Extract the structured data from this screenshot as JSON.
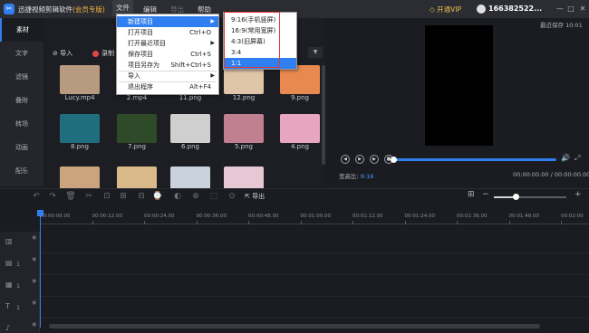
{
  "titlebar": {
    "app_title": "迅捷视频剪辑软件",
    "vip_tag": "(会员专版)",
    "menu": {
      "file": "文件",
      "edit": "编辑",
      "export": "导出",
      "help": "帮助"
    },
    "vip_button": "开通VIP",
    "user": "166382522...",
    "minimize": "—",
    "maximize": "□",
    "close": "✕"
  },
  "leftnav": {
    "items": [
      {
        "label": "素材"
      },
      {
        "label": "文字"
      },
      {
        "label": "滤镜"
      },
      {
        "label": "叠附"
      },
      {
        "label": "转场"
      },
      {
        "label": "动画"
      },
      {
        "label": "配乐"
      }
    ]
  },
  "media": {
    "import_label": "导入",
    "record_label": "录制",
    "sort_arrow": "▼",
    "items": [
      {
        "name": "Lucy.mp4",
        "color": "#b89a80"
      },
      {
        "name": "2.mp4",
        "color": "#d9d2c3"
      },
      {
        "name": "11.png",
        "color": "#2a3a4a"
      },
      {
        "name": "12.png",
        "color": "#e0c6a8"
      },
      {
        "name": "9.png",
        "color": "#e88a50"
      },
      {
        "name": "8.png",
        "color": "#1f6d7d"
      },
      {
        "name": "7.png",
        "color": "#2f4a28"
      },
      {
        "name": "6.png",
        "color": "#cfcfcf"
      },
      {
        "name": "5.png",
        "color": "#c08090"
      },
      {
        "name": "4.png",
        "color": "#e7a5c0"
      },
      {
        "name": "",
        "color": "#caa47c"
      },
      {
        "name": "",
        "color": "#d9b98a"
      },
      {
        "name": "",
        "color": "#cad2de"
      },
      {
        "name": "",
        "color": "#e6c7d4"
      }
    ]
  },
  "preview": {
    "last_save": "最近保存 10:01",
    "ratio_label": "宽高比:",
    "ratio_value": "9:16",
    "time": "00:00:00.00 / 00:00:00.00",
    "btn_prev": "◀",
    "btn_play": "▶",
    "btn_next": "▶",
    "btn_stop": "■",
    "volume_icon": "🔊",
    "fullscreen_icon": "⤢"
  },
  "toolbar": {
    "export_label": "导出",
    "icons": [
      "↶",
      "↷",
      "🗑",
      "✂",
      "⊡",
      "⊞",
      "⊟",
      "⌚",
      "◐",
      "⊕",
      "⬚",
      "⊙",
      "🎤",
      "≡"
    ],
    "zoom_out": "−",
    "zoom_in": "+",
    "zoom_level": 0.3
  },
  "timeline": {
    "ticks": [
      "00:00:00.00",
      "00:00:12.00",
      "00:00:24.00",
      "00:00:36.00",
      "00:00:48.00",
      "00:01:00.00",
      "00:01:12.00",
      "00:01:24.00",
      "00:01:36.00",
      "00:01:48.00",
      "00:02:00"
    ],
    "tracks": [
      {
        "icon": "▥",
        "index": "",
        "eye": "◉"
      },
      {
        "icon": "▤",
        "index": "1",
        "eye": "◉"
      },
      {
        "icon": "▦",
        "index": "1",
        "eye": "◉"
      },
      {
        "icon": "T",
        "index": "1",
        "eye": "◉"
      },
      {
        "icon": "♪",
        "index": "",
        "eye": "◉"
      }
    ]
  },
  "file_menu": {
    "items": [
      {
        "label": "新建项目",
        "shortcut": "",
        "arrow": "▶",
        "highlighted": true
      },
      {
        "label": "打开项目",
        "shortcut": "Ctrl+O",
        "arrow": "",
        "highlighted": false
      },
      {
        "label": "打开最近项目",
        "shortcut": "",
        "arrow": "▶",
        "highlighted": false
      },
      {
        "label": "保存项目",
        "shortcut": "Ctrl+S",
        "arrow": "",
        "highlighted": false
      },
      {
        "label": "项目另存为",
        "shortcut": "Shift+Ctrl+S",
        "arrow": "",
        "highlighted": false
      },
      {
        "label": "导入",
        "shortcut": "",
        "arrow": "▶",
        "highlighted": false
      },
      {
        "label": "退出程序",
        "shortcut": "Alt+F4",
        "arrow": "",
        "highlighted": false
      }
    ]
  },
  "new_project_submenu": {
    "items": [
      {
        "label": "9:16(手机竖屏)",
        "highlighted": false
      },
      {
        "label": "16:9(常用宽屏)",
        "highlighted": false
      },
      {
        "label": "4:3(旧屏幕)",
        "highlighted": false
      },
      {
        "label": "3:4",
        "highlighted": false
      },
      {
        "label": "1:1",
        "highlighted": true
      }
    ]
  }
}
